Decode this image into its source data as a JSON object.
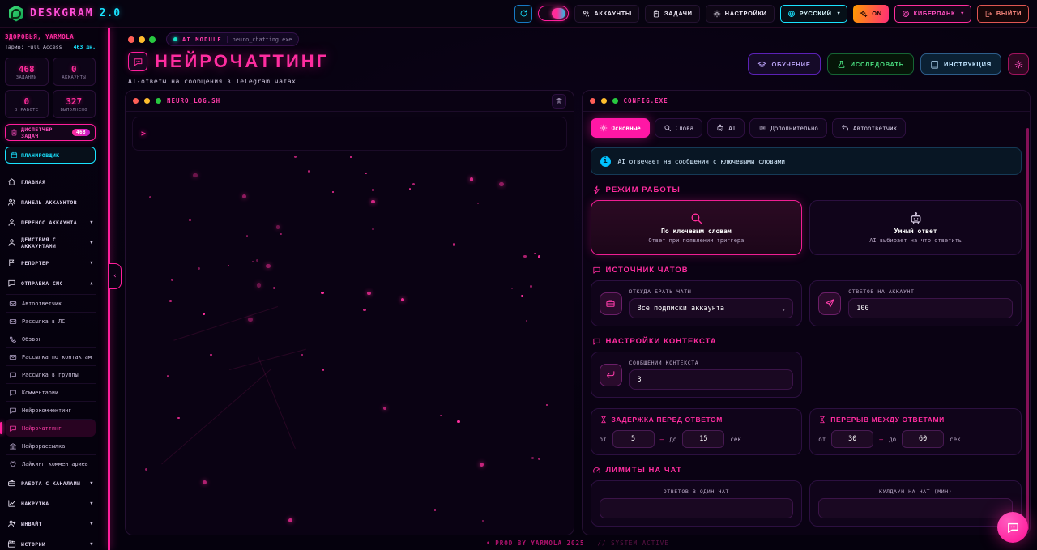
{
  "topbar": {
    "logo_name": "DESKGRAM",
    "logo_version": "2.0",
    "accounts": "АККАУНТЫ",
    "tasks": "ЗАДАЧИ",
    "settings": "НАСТРОЙКИ",
    "language": "РУССКИЙ",
    "power": "ON",
    "theme": "КИБЕРПАНК",
    "logout": "ВЫЙТИ",
    "caret": "▾"
  },
  "sidebar": {
    "greeting": "ЗДОРОВЬЯ, YARMOLA",
    "tariff": "Тариф: Full Access",
    "days_left": "463 дн.",
    "stats": [
      {
        "value": "468",
        "label": "ЗАДАНИЙ"
      },
      {
        "value": "0",
        "label": "АККАУНТЫ"
      },
      {
        "value": "0",
        "label": "В РАБОТЕ"
      },
      {
        "value": "327",
        "label": "ВЫПОЛНЕНО"
      }
    ],
    "task_manager": "ДИСПЕТЧЕР ЗАДАЧ",
    "task_manager_badge": "468",
    "scheduler": "ПЛАНИРОВЩИК",
    "menu_top": [
      {
        "label": "ГЛАВНАЯ",
        "icon": "home",
        "arrow": ""
      },
      {
        "label": "ПАНЕЛЬ АККАУНТОВ",
        "icon": "users",
        "arrow": ""
      },
      {
        "label": "ПЕРЕНОС АККАУНТА",
        "icon": "user",
        "arrow": "▼"
      },
      {
        "label": "ДЕЙСТВИЯ С АККАУНТАМИ",
        "icon": "user",
        "arrow": "▼"
      },
      {
        "label": "РЕПОРТЕР",
        "icon": "flag",
        "arrow": "▼"
      },
      {
        "label": "ОТПРАВКА СМС",
        "icon": "comment",
        "arrow": "▲"
      }
    ],
    "submenu_sms": [
      {
        "label": "Автоответчик",
        "icon": "envelope"
      },
      {
        "label": "Рассылка в ЛС",
        "icon": "envelope"
      },
      {
        "label": "Обзвон",
        "icon": "phone"
      },
      {
        "label": "Рассылка по контактам",
        "icon": "envelope"
      },
      {
        "label": "Рассылка в группы",
        "icon": "comment"
      },
      {
        "label": "Комментарии",
        "icon": "comment"
      },
      {
        "label": "Нейрокомментинг",
        "icon": "comment"
      },
      {
        "label": "Нейрочаттинг",
        "icon": "chat",
        "active": true
      },
      {
        "label": "Нейрорассылка",
        "icon": "bank"
      },
      {
        "label": "Лайкинг комментариев",
        "icon": "heart"
      }
    ],
    "menu_bottom": [
      {
        "label": "РАБОТА С КАНАЛАМИ",
        "icon": "briefcase",
        "arrow": "▼"
      },
      {
        "label": "НАКРУТКА",
        "icon": "chart",
        "arrow": "▼"
      },
      {
        "label": "ИНВАЙТ",
        "icon": "user-plus",
        "arrow": "▼"
      },
      {
        "label": "ИСТОРИИ",
        "icon": "clapper",
        "arrow": "▼"
      }
    ]
  },
  "header": {
    "module_badge": "AI MODULE",
    "module_file": "neuro_chatting.exe",
    "title": "НЕЙРОЧАТТИНГ",
    "subtitle": "AI-ответы на сообщения в Telegram чатах",
    "training": "ОБУЧЕНИЕ",
    "research": "ИССЛЕДОВАТЬ",
    "instruction": "ИНСТРУКЦИЯ"
  },
  "log_panel": {
    "title": "NEURO_LOG.SH",
    "prompt": ">"
  },
  "config_panel": {
    "title": "CONFIG.EXE",
    "tabs": [
      {
        "label": "Основные",
        "icon": "gear",
        "active": true
      },
      {
        "label": "Слова",
        "icon": "search"
      },
      {
        "label": "AI",
        "icon": "robot"
      },
      {
        "label": "Дополнительно",
        "icon": "sliders"
      },
      {
        "label": "Автоответчик",
        "icon": "reply"
      }
    ],
    "info_banner": "AI отвечает на сообщения с ключевыми словами",
    "mode_section": {
      "title": "РЕЖИМ РАБОТЫ",
      "cards": [
        {
          "title": "По ключевым словам",
          "subtitle": "Ответ при появлении триггера",
          "icon": "search",
          "selected": true
        },
        {
          "title": "Умный ответ",
          "subtitle": "AI выбирает на что ответить",
          "icon": "robot"
        }
      ]
    },
    "source_section": {
      "title": "ИСТОЧНИК ЧАТОВ",
      "source_label": "ОТКУДА БРАТЬ ЧАТЫ",
      "source_value": "Все подписки аккаунта",
      "chevron": "⌄",
      "replies_label": "ОТВЕТОВ НА АККАУНТ",
      "replies_value": "100"
    },
    "context_section": {
      "title": "НАСТРОЙКИ КОНТЕКСТА",
      "context_label": "СООБЩЕНИЙ КОНТЕКСТА",
      "context_value": "3"
    },
    "delay_section": {
      "title": "ЗАДЕРЖКА ПЕРЕД ОТВЕТОМ",
      "from_label": "от",
      "from_value": "5",
      "to_label": "до",
      "to_value": "15",
      "dash": "—",
      "unit": "сек"
    },
    "pause_section": {
      "title": "ПЕРЕРЫВ МЕЖДУ ОТВЕТАМИ",
      "from_label": "от",
      "from_value": "30",
      "to_label": "до",
      "to_value": "60",
      "dash": "—",
      "unit": "сек"
    },
    "limits_section": {
      "title": "ЛИМИТЫ НА ЧАТ",
      "per_chat_label": "ОТВЕТОВ В ОДИН ЧАТ",
      "cooldown_label": "КУЛДАУН НА ЧАТ (МИН)"
    }
  },
  "footer": {
    "left": "• PROD BY YARMOLA 2025",
    "right": "// SYSTEM ACTIVE"
  }
}
